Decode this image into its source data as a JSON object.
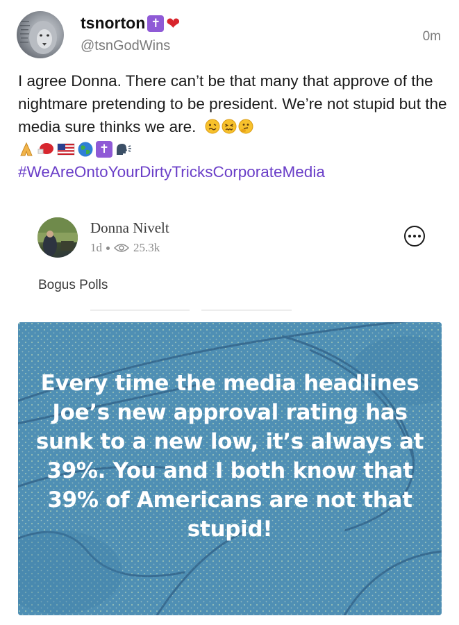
{
  "post": {
    "username": "tsnorton",
    "badge_cross": "✝",
    "badge_heart": "❤",
    "handle": "@tsnGodWins",
    "time": "0m",
    "text": "I agree Donna. There can’t be that many that approve of the nightmare pretending to be president. We’re not stupid but the media sure thinks we are.",
    "hashtag": "#WeAreOntoYourDirtyTricksCorporateMedia"
  },
  "quoted": {
    "name": "Donna Nivelt",
    "age": "1d",
    "views": "25.3k",
    "text": "Bogus Polls",
    "image_text": "Every time the media headlines Joe’s new approval rating has sunk to a new low, it’s always at 39%. You and I both know that 39% of Americans are not that stupid!"
  },
  "emojis": {
    "inline": [
      "woozy-face",
      "confounded-face",
      "thinking-face"
    ],
    "row": [
      "folded-hands",
      "boxing-glove",
      "us-flag",
      "globe",
      "latin-cross",
      "speaking-head"
    ]
  },
  "colors": {
    "hashtag": "#6a3ec8",
    "badge": "#8f5ad6",
    "meme_bg": "#4f8fb4"
  }
}
